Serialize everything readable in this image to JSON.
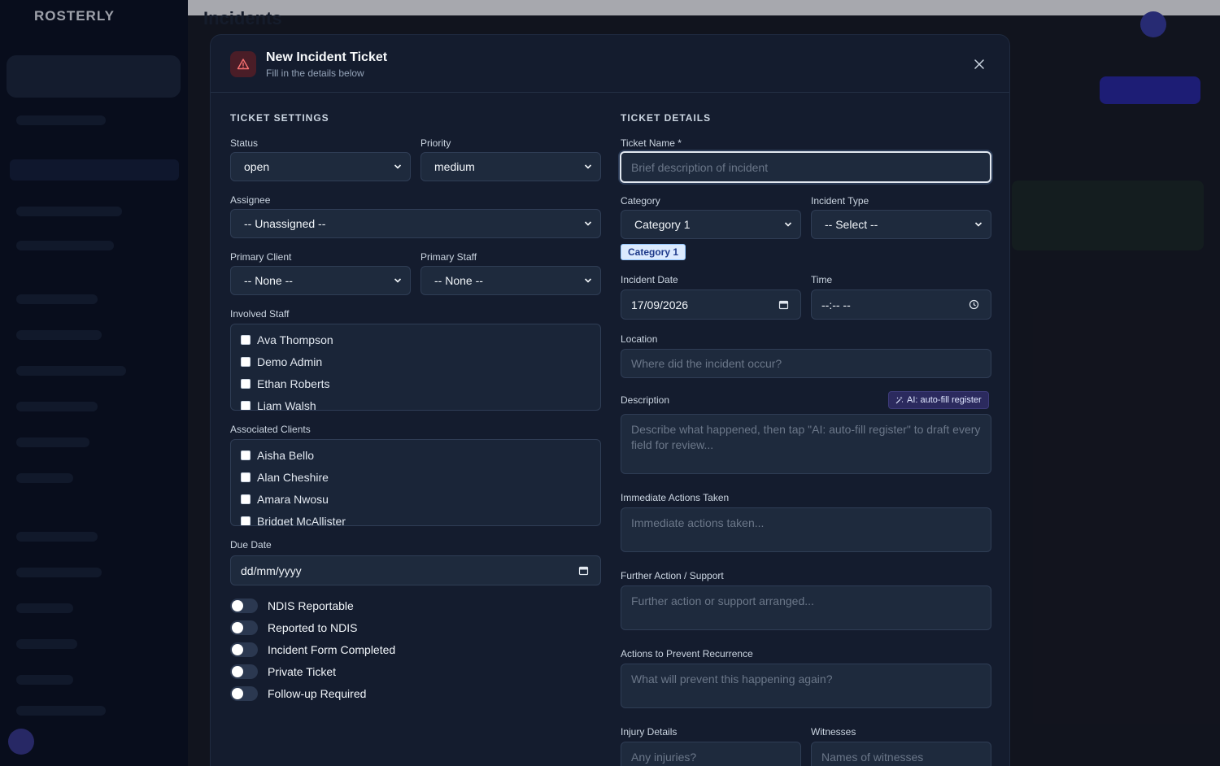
{
  "background": {
    "logo": "ROSTERLY",
    "page_title": "Incidents"
  },
  "modal": {
    "title": "New Incident Ticket",
    "subtitle": "Fill in the details below",
    "header_icon": "warning-triangle-icon",
    "close_icon": "close-icon"
  },
  "settings": {
    "section_title": "TICKET SETTINGS",
    "status": {
      "label": "Status",
      "value": "open"
    },
    "priority": {
      "label": "Priority",
      "value": "medium"
    },
    "assignee": {
      "label": "Assignee",
      "value": "-- Unassigned --"
    },
    "primary_client": {
      "label": "Primary Client",
      "value": "-- None --"
    },
    "primary_staff": {
      "label": "Primary Staff",
      "value": "-- None --"
    },
    "involved_staff": {
      "label": "Involved Staff",
      "items": [
        "Ava Thompson",
        "Demo Admin",
        "Ethan Roberts",
        "Liam Walsh"
      ]
    },
    "associated_clients": {
      "label": "Associated Clients",
      "items": [
        "Aisha Bello",
        "Alan Cheshire",
        "Amara Nwosu",
        "Bridget McAllister"
      ]
    },
    "due_date": {
      "label": "Due Date",
      "placeholder": "dd/mm/yyyy"
    },
    "toggles": [
      {
        "label": "NDIS Reportable",
        "on": false
      },
      {
        "label": "Reported to NDIS",
        "on": false
      },
      {
        "label": "Incident Form Completed",
        "on": false
      },
      {
        "label": "Private Ticket",
        "on": false
      },
      {
        "label": "Follow-up Required",
        "on": false
      }
    ]
  },
  "details": {
    "section_title": "TICKET DETAILS",
    "ticket_name": {
      "label": "Ticket Name *",
      "placeholder": "Brief description of incident"
    },
    "category": {
      "label": "Category",
      "value": "Category 1",
      "badge": "Category 1"
    },
    "incident_type": {
      "label": "Incident Type",
      "value": "-- Select --"
    },
    "incident_date": {
      "label": "Incident Date",
      "value": "17/09/2026"
    },
    "time": {
      "label": "Time",
      "value": "--:-- --"
    },
    "location": {
      "label": "Location",
      "placeholder": "Where did the incident occur?"
    },
    "description": {
      "label": "Description",
      "ai_button": "AI: auto-fill register",
      "placeholder": "Describe what happened, then tap \"AI: auto-fill register\" to draft every field for review..."
    },
    "immediate_actions": {
      "label": "Immediate Actions Taken",
      "placeholder": "Immediate actions taken..."
    },
    "further_action": {
      "label": "Further Action / Support",
      "placeholder": "Further action or support arranged..."
    },
    "prevent_recurrence": {
      "label": "Actions to Prevent Recurrence",
      "placeholder": "What will prevent this happening again?"
    },
    "injury_details": {
      "label": "Injury Details",
      "placeholder": "Any injuries?"
    },
    "witnesses": {
      "label": "Witnesses",
      "placeholder": "Names of witnesses"
    }
  },
  "colors": {
    "modal_bg": "#141c2e",
    "field_bg": "#1e2a3d",
    "accent_danger": "#f87171",
    "ai_button_bg": "#2b2a5e"
  }
}
